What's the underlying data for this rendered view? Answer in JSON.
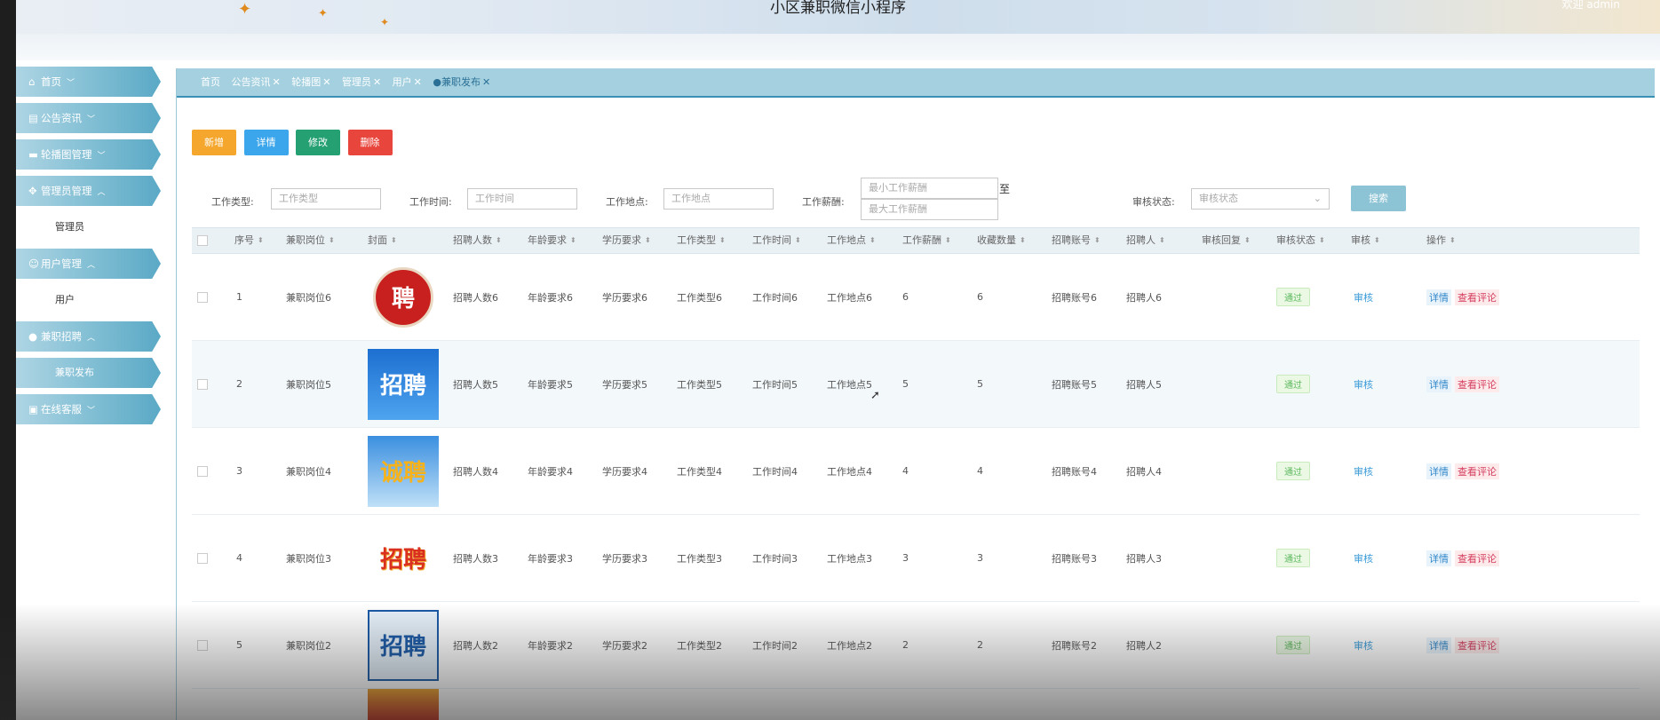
{
  "header": {
    "title": "小区兼职微信小程序",
    "welcome": "欢迎 admin"
  },
  "sidebar": {
    "items": [
      {
        "label": "首页",
        "chev": "﹀"
      },
      {
        "label": "公告资讯",
        "chev": "﹀"
      },
      {
        "label": "轮播图管理",
        "chev": "﹀"
      },
      {
        "label": "管理员管理",
        "chev": "︿"
      },
      {
        "label": "管理员"
      },
      {
        "label": "用户管理",
        "chev": "︿"
      },
      {
        "label": "用户"
      },
      {
        "label": "兼职招聘",
        "chev": "︿"
      },
      {
        "label": "兼职发布"
      },
      {
        "label": "在线客服",
        "chev": "﹀"
      }
    ]
  },
  "tabs": [
    {
      "label": "首页"
    },
    {
      "label": "公告资讯"
    },
    {
      "label": "轮播图"
    },
    {
      "label": "管理员"
    },
    {
      "label": "用户"
    },
    {
      "label": "●兼职发布"
    }
  ],
  "toolbar": {
    "add": "新增",
    "detail": "详情",
    "edit": "修改",
    "delete": "删除"
  },
  "filters": {
    "type_label": "工作类型:",
    "type_ph": "工作类型",
    "time_label": "工作时间:",
    "time_ph": "工作时间",
    "place_label": "工作地点:",
    "place_ph": "工作地点",
    "salary_label": "工作薪酬:",
    "salary_min_ph": "最小工作薪酬",
    "salary_to": "至",
    "salary_max_ph": "最大工作薪酬",
    "status_label": "审核状态:",
    "status_ph": "审核状态",
    "search": "搜索"
  },
  "table": {
    "headers": [
      "序号",
      "兼职岗位",
      "封面",
      "招聘人数",
      "年龄要求",
      "学历要求",
      "工作类型",
      "工作时间",
      "工作地点",
      "工作薪酬",
      "收藏数量",
      "招聘账号",
      "招聘人",
      "审核回复",
      "审核状态",
      "审核",
      "操作"
    ],
    "rows": [
      {
        "no": "1",
        "post": "兼职岗位6",
        "cover": "聘",
        "count": "招聘人数6",
        "age": "年龄要求6",
        "edu": "学历要求6",
        "type": "工作类型6",
        "time": "工作时间6",
        "place": "工作地点6",
        "salary": "6",
        "fav": "6",
        "account": "招聘账号6",
        "person": "招聘人6",
        "status": "通过",
        "audit": "审核",
        "op_detail": "详情",
        "op_comment": "查看评论"
      },
      {
        "no": "2",
        "post": "兼职岗位5",
        "cover": "招聘",
        "count": "招聘人数5",
        "age": "年龄要求5",
        "edu": "学历要求5",
        "type": "工作类型5",
        "time": "工作时间5",
        "place": "工作地点5",
        "salary": "5",
        "fav": "5",
        "account": "招聘账号5",
        "person": "招聘人5",
        "status": "通过",
        "audit": "审核",
        "op_detail": "详情",
        "op_comment": "查看评论"
      },
      {
        "no": "3",
        "post": "兼职岗位4",
        "cover": "诚聘",
        "count": "招聘人数4",
        "age": "年龄要求4",
        "edu": "学历要求4",
        "type": "工作类型4",
        "time": "工作时间4",
        "place": "工作地点4",
        "salary": "4",
        "fav": "4",
        "account": "招聘账号4",
        "person": "招聘人4",
        "status": "通过",
        "audit": "审核",
        "op_detail": "详情",
        "op_comment": "查看评论"
      },
      {
        "no": "4",
        "post": "兼职岗位3",
        "cover": "招聘",
        "count": "招聘人数3",
        "age": "年龄要求3",
        "edu": "学历要求3",
        "type": "工作类型3",
        "time": "工作时间3",
        "place": "工作地点3",
        "salary": "3",
        "fav": "3",
        "account": "招聘账号3",
        "person": "招聘人3",
        "status": "通过",
        "audit": "审核",
        "op_detail": "详情",
        "op_comment": "查看评论"
      },
      {
        "no": "5",
        "post": "兼职岗位2",
        "cover": "招聘",
        "count": "招聘人数2",
        "age": "年龄要求2",
        "edu": "学历要求2",
        "type": "工作类型2",
        "time": "工作时间2",
        "place": "工作地点2",
        "salary": "2",
        "fav": "2",
        "account": "招聘账号2",
        "person": "招聘人2",
        "status": "通过",
        "audit": "审核",
        "op_detail": "详情",
        "op_comment": "查看评论"
      }
    ]
  },
  "colors": {
    "accent": "#3a8fb5",
    "sidebar": "#7fbdd3",
    "ok": "#5cb85c",
    "danger": "#e8453c"
  }
}
